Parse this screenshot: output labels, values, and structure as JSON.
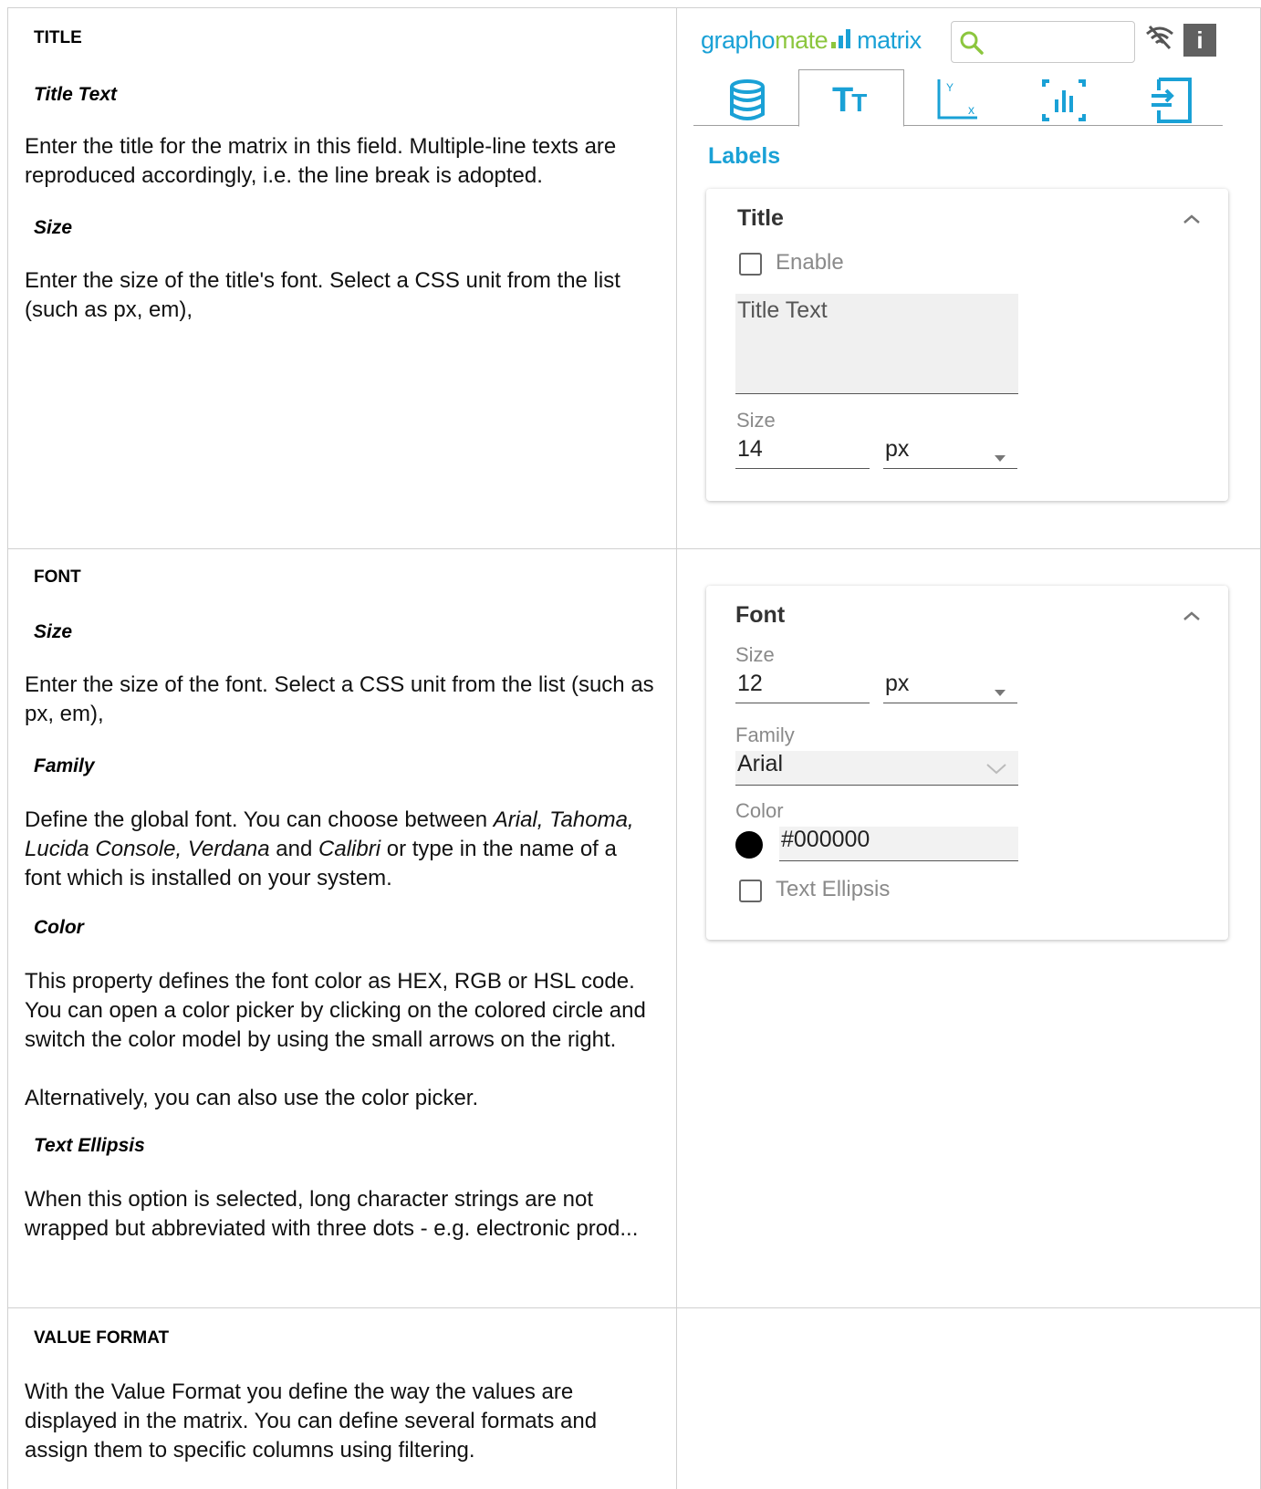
{
  "sections": {
    "title": {
      "heading": "TITLE",
      "title_text_heading": "Title Text",
      "title_text_desc": "Enter the title for the matrix in this field. Multiple-line texts are reproduced accordingly, i.e. the line break is adopted.",
      "size_heading": "Size",
      "size_desc": "Enter the size of the title's font. Select a CSS unit from the list (such as px, em),"
    },
    "font": {
      "heading": "FONT",
      "size_heading": "Size",
      "size_desc": "Enter the size of the font. Select a CSS unit from the list (such as px, em),",
      "family_heading": "Family",
      "family_desc_1": "Define the global font. You can choose between ",
      "family_fonts_1": "Arial, Tahoma, Lucida Console, Verdana",
      "family_and": " and ",
      "family_fonts_2": "Calibri",
      "family_desc_2": " or type in the name of a font which is installed on your system.",
      "color_heading": "Color",
      "color_desc_1": "This property defines the font color as HEX, RGB or HSL code. You can open a color picker by clicking on the colored circle and switch the color model by using the small arrows on the right.",
      "color_desc_2": "Alternatively, you can also use the color picker.",
      "ellipsis_heading": "Text Ellipsis",
      "ellipsis_desc": "When this option is selected, long character strings are not wrapped but abbreviated with three dots - e.g. electronic prod..."
    },
    "value_format": {
      "heading": "VALUE FORMAT",
      "desc": "With the Value Format you define the way the values are displayed in the matrix. You can define several formats and assign them to specific columns using filtering."
    }
  },
  "panel": {
    "logo_graph": "grapho",
    "logo_mate": "mate",
    "logo_matrix": "matrix",
    "search_icon": "search-icon",
    "tabs": [
      "data-icon",
      "text-icon",
      "axis-icon",
      "chart-icon",
      "export-icon"
    ],
    "section_label": "Labels",
    "title_card": {
      "title": "Title",
      "enable_label": "Enable",
      "title_text_placeholder": "Title Text",
      "size_label": "Size",
      "size_value": "14",
      "unit_value": "px"
    },
    "font_card": {
      "title": "Font",
      "size_label": "Size",
      "size_value": "12",
      "unit_value": "px",
      "family_label": "Family",
      "family_value": "Arial",
      "color_label": "Color",
      "color_value": "#000000",
      "ellipsis_label": "Text Ellipsis"
    }
  },
  "colors": {
    "accent": "#1aa1d6",
    "logo_green": "#8cc63e"
  }
}
